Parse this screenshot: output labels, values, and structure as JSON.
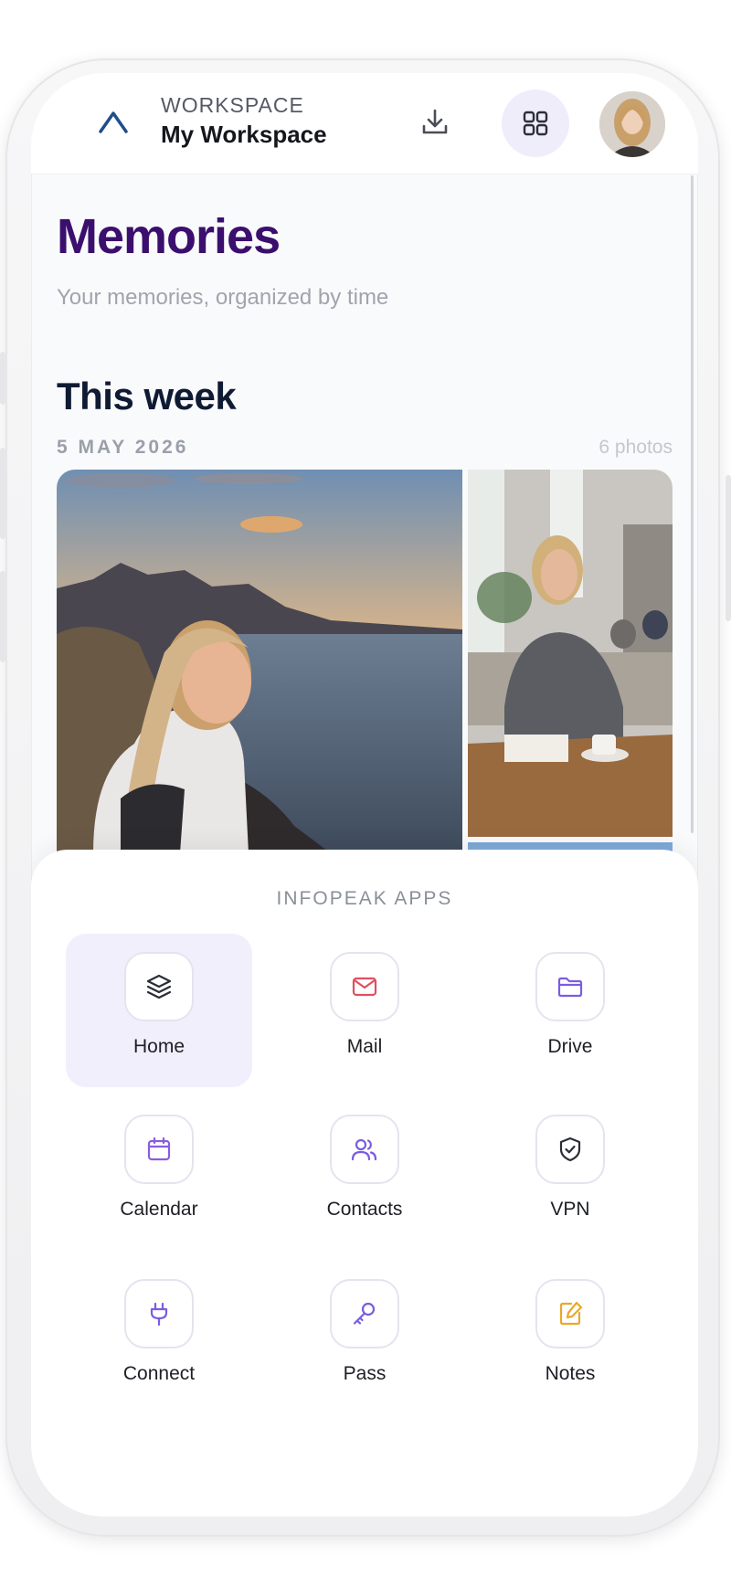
{
  "header": {
    "workspace_label": "WORKSPACE",
    "workspace_name": "My Workspace"
  },
  "memories": {
    "title": "Memories",
    "subtitle": "Your memories, organized by time"
  },
  "section": {
    "title": "This week",
    "date": "5 MAY 2026",
    "photo_count": "6 photos"
  },
  "apps_sheet": {
    "title": "INFOPEAK APPS",
    "apps": [
      {
        "label": "Home",
        "icon": "layers-icon",
        "color": "#2b2d36",
        "active": true
      },
      {
        "label": "Mail",
        "icon": "mail-icon",
        "color": "#e0505f",
        "active": false
      },
      {
        "label": "Drive",
        "icon": "folder-icon",
        "color": "#7b5ce0",
        "active": false
      },
      {
        "label": "Calendar",
        "icon": "calendar-icon",
        "color": "#8a5ce0",
        "active": false
      },
      {
        "label": "Contacts",
        "icon": "users-icon",
        "color": "#7b5ce0",
        "active": false
      },
      {
        "label": "VPN",
        "icon": "shield-icon",
        "color": "#2b2d36",
        "active": false
      },
      {
        "label": "Connect",
        "icon": "plug-icon",
        "color": "#7b5ce0",
        "active": false
      },
      {
        "label": "Pass",
        "icon": "key-icon",
        "color": "#7b5ce0",
        "active": false
      },
      {
        "label": "Notes",
        "icon": "note-icon",
        "color": "#e9a82b",
        "active": false
      }
    ]
  },
  "colors": {
    "brand_purple": "#3b0f6e",
    "accent_bg": "#efedfa"
  }
}
